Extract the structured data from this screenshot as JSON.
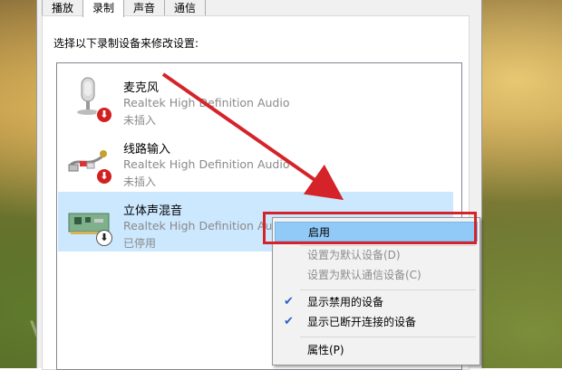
{
  "tabs": [
    "播放",
    "录制",
    "声音",
    "通信"
  ],
  "active_tab": 1,
  "instruction": "选择以下录制设备来修改设置:",
  "devices": [
    {
      "name": "麦克风",
      "driver": "Realtek High Definition Audio",
      "status": "未插入",
      "icon": "microphone-icon",
      "badge": "red-down-arrow"
    },
    {
      "name": "线路输入",
      "driver": "Realtek High Definition Audio",
      "status": "未插入",
      "icon": "line-in-cable-icon",
      "badge": "red-down-arrow"
    },
    {
      "name": "立体声混音",
      "driver": "Realtek High Definition Audio",
      "status": "已停用",
      "icon": "sound-card-icon",
      "badge": "disabled-down-arrow"
    }
  ],
  "context_menu": {
    "items": [
      {
        "label": "启用",
        "state": "highlighted"
      },
      {
        "label": "设置为默认设备(D)",
        "state": "disabled"
      },
      {
        "label": "设置为默认通信设备(C)",
        "state": "disabled"
      },
      {
        "label": "显示禁用的设备",
        "checked": true
      },
      {
        "label": "显示已断开连接的设备",
        "checked": true
      },
      {
        "label": "属性(P)"
      }
    ]
  },
  "colors": {
    "selection": "#cce8ff",
    "menu_highlight": "#91c9f7",
    "annotation_red": "#d4242a",
    "badge_red": "#d21f1f"
  }
}
